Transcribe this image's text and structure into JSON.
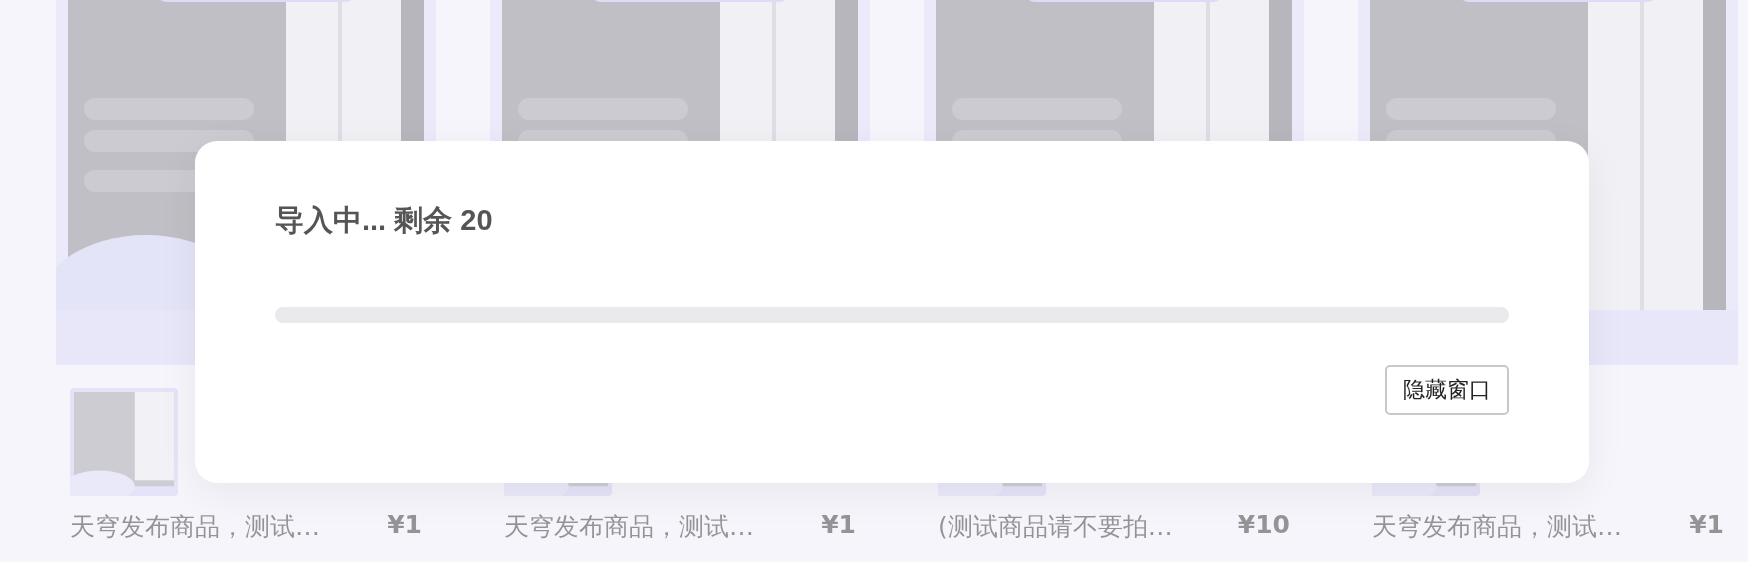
{
  "products": [
    {
      "kind": "picture",
      "title": "天穹发布商品，测试…",
      "price": "¥1"
    },
    {
      "kind": "picture",
      "title": "天穹发布商品，测试…",
      "price": "¥1"
    },
    {
      "kind": "picture",
      "title": "(测试商品请不要拍…",
      "price": "¥10"
    },
    {
      "kind": "picture",
      "title": "天穹发布商品，测试…",
      "price": "¥1"
    }
  ],
  "dialog": {
    "title": "导入中... 剩余 20",
    "progress": {
      "level": 0
    },
    "buttons": [
      {
        "label": "隐藏窗口"
      }
    ]
  }
}
